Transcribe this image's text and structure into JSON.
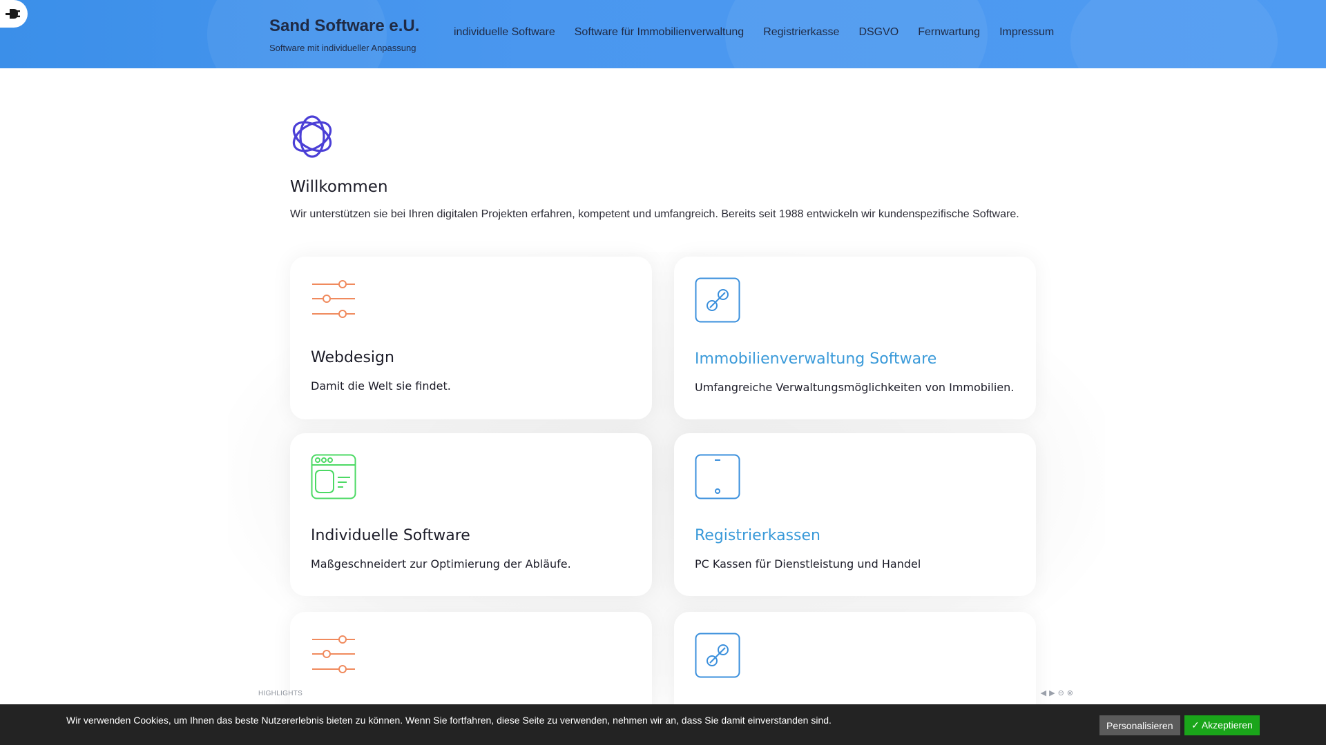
{
  "header": {
    "brand_title": "Sand Software e.U.",
    "brand_subtitle": "Software mit individueller Anpassung",
    "nav": [
      {
        "label": "individuelle Software"
      },
      {
        "label": "Software für Immobilienverwaltung"
      },
      {
        "label": "Registrierkasse"
      },
      {
        "label": "DSGVO"
      },
      {
        "label": "Fernwartung"
      },
      {
        "label": "Impressum"
      }
    ],
    "plugin_icon": "plug-icon"
  },
  "welcome": {
    "logo_icon": "flower-logo-icon",
    "title": "Willkommen",
    "text": "Wir unterstützen sie bei Ihren digitalen Projekten erfahren, kompetent und umfangreich. Bereits seit 1988 entwickeln wir kundenspezifische Software."
  },
  "cards": [
    {
      "title": "Webdesign",
      "text": "Damit die Welt sie findet.",
      "icon": "sliders-icon",
      "is_link": false
    },
    {
      "title": "Immobilienverwaltung Software",
      "text": "Umfangreiche Verwaltungsmöglichkeiten von Immobilien.",
      "icon": "link-icon",
      "is_link": true
    },
    {
      "title": "Individuelle Software",
      "text": "Maßgeschneidert zur Optimierung der Abläufe.",
      "icon": "browser-window-icon",
      "is_link": false
    },
    {
      "title": "Registrierkassen",
      "text": "PC Kassen für Dienstleistung und Handel",
      "icon": "tablet-icon",
      "is_link": true
    },
    {
      "title": "",
      "text": "",
      "icon": "sliders-icon",
      "is_link": false
    },
    {
      "title": "",
      "text": "",
      "icon": "link-icon",
      "is_link": false
    }
  ],
  "highlights": {
    "label": "HIGHLIGHTS"
  },
  "cookie": {
    "text": "Wir verwenden Cookies, um Ihnen das beste Nutzererlebnis bieten zu können. Wenn Sie fortfahren, diese Seite zu verwenden, nehmen wir an, dass Sie damit einverstanden sind.",
    "personalize_label": "Personalisieren",
    "accept_label": "✓ Akzeptieren"
  },
  "colors": {
    "header_blue": "#4a97ef",
    "link_blue": "#3a9ad9",
    "logo_purple": "#4b3fd6",
    "icon_orange": "#f08a5d",
    "icon_green": "#4cd964",
    "cookie_bg": "#232323",
    "accept_green": "#1aa51a",
    "personalize_gray": "#5b5b5b"
  }
}
